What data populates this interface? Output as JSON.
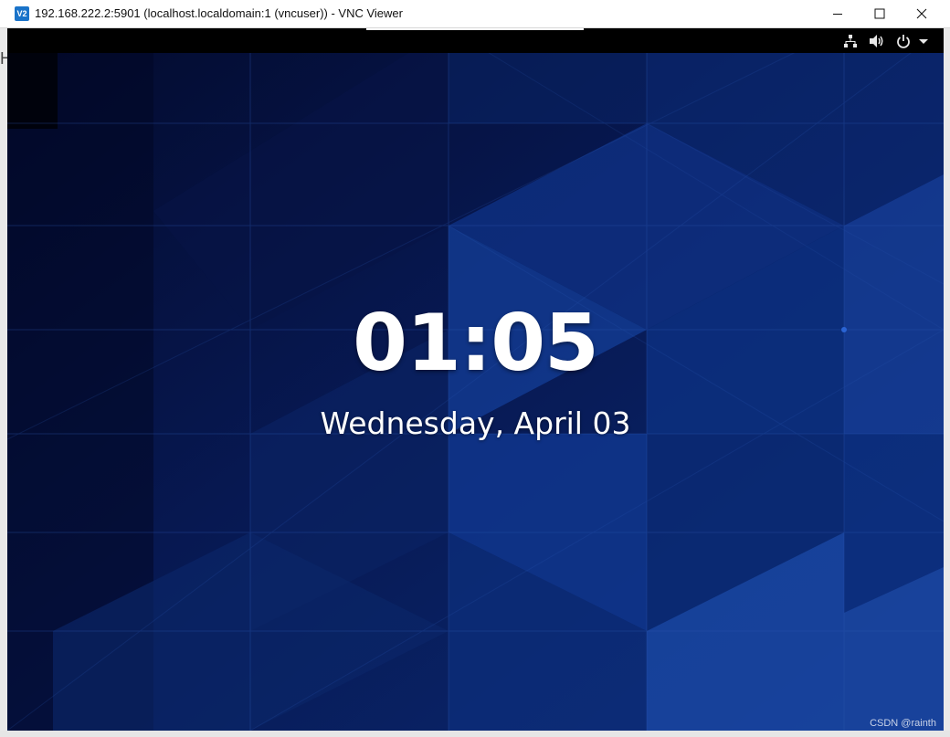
{
  "window": {
    "title": "192.168.222.2:5901 (localhost.localdomain:1 (vncuser)) - VNC Viewer",
    "app_icon_text": "V2"
  },
  "window_controls": {
    "minimize_icon": "minimize-icon",
    "maximize_icon": "maximize-icon",
    "close_icon": "close-icon"
  },
  "panel": {
    "icons": [
      "network-icon",
      "volume-icon",
      "power-icon",
      "chevron-down-icon"
    ]
  },
  "lock_screen": {
    "time": "01:05",
    "date": "Wednesday, April 03"
  },
  "watermark": "CSDN @rainth",
  "colors": {
    "wallpaper_dark": "#050e35",
    "wallpaper_mid": "#0d2f7a",
    "wallpaper_light": "#1f5cc4",
    "panel": "#000000",
    "text": "#ffffff"
  }
}
